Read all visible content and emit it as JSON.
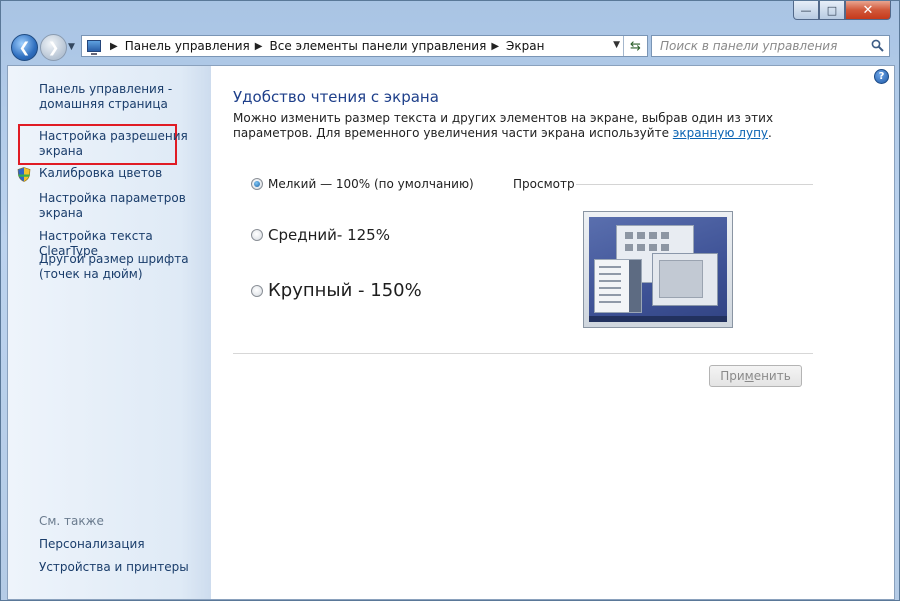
{
  "window": {
    "caption_buttons": {
      "minimize": "—",
      "maximize": "□",
      "close": "✕"
    }
  },
  "nav": {
    "back_icon": "back-arrow-icon",
    "forward_icon": "forward-arrow-icon",
    "address": {
      "crumbs": [
        "Панель управления",
        "Все элементы панели управления",
        "Экран"
      ]
    },
    "search_placeholder": "Поиск в панели управления"
  },
  "sidebar": {
    "home_link": "Панель управления - домашняя страница",
    "items": [
      {
        "label": "Настройка разрешения экрана",
        "highlighted": true
      },
      {
        "label": "Калибровка цветов",
        "icon": "uac-shield-icon"
      },
      {
        "label": "Настройка параметров экрана"
      },
      {
        "label": "Настройка текста ClearType"
      },
      {
        "label": "Другой размер шрифта (точек на дюйм)"
      }
    ],
    "see_also_heading": "См. также",
    "see_also": [
      "Персонализация",
      "Устройства и принтеры"
    ],
    "highlight_color": "#e01b24"
  },
  "main": {
    "title": "Удобство чтения с экрана",
    "description_before_link": "Можно изменить размер текста и других элементов на экране, выбрав один из этих параметров. Для временного увеличения части экрана используйте",
    "description_link": "экранную лупу",
    "description_after_link": ".",
    "options": [
      {
        "label": "Мелкий — 100% (по умолчанию)",
        "checked": true
      },
      {
        "label": "Средний- 125%",
        "checked": false
      },
      {
        "label": "Крупный - 150%",
        "checked": false
      }
    ],
    "preview_label": "Просмотр",
    "apply_button": {
      "before": "При",
      "underlined": "м",
      "after": "енить",
      "enabled": false
    }
  },
  "colors": {
    "title": "#1e3f8a",
    "link": "#0a63b3",
    "sidebar_link": "#1a3d6b"
  }
}
